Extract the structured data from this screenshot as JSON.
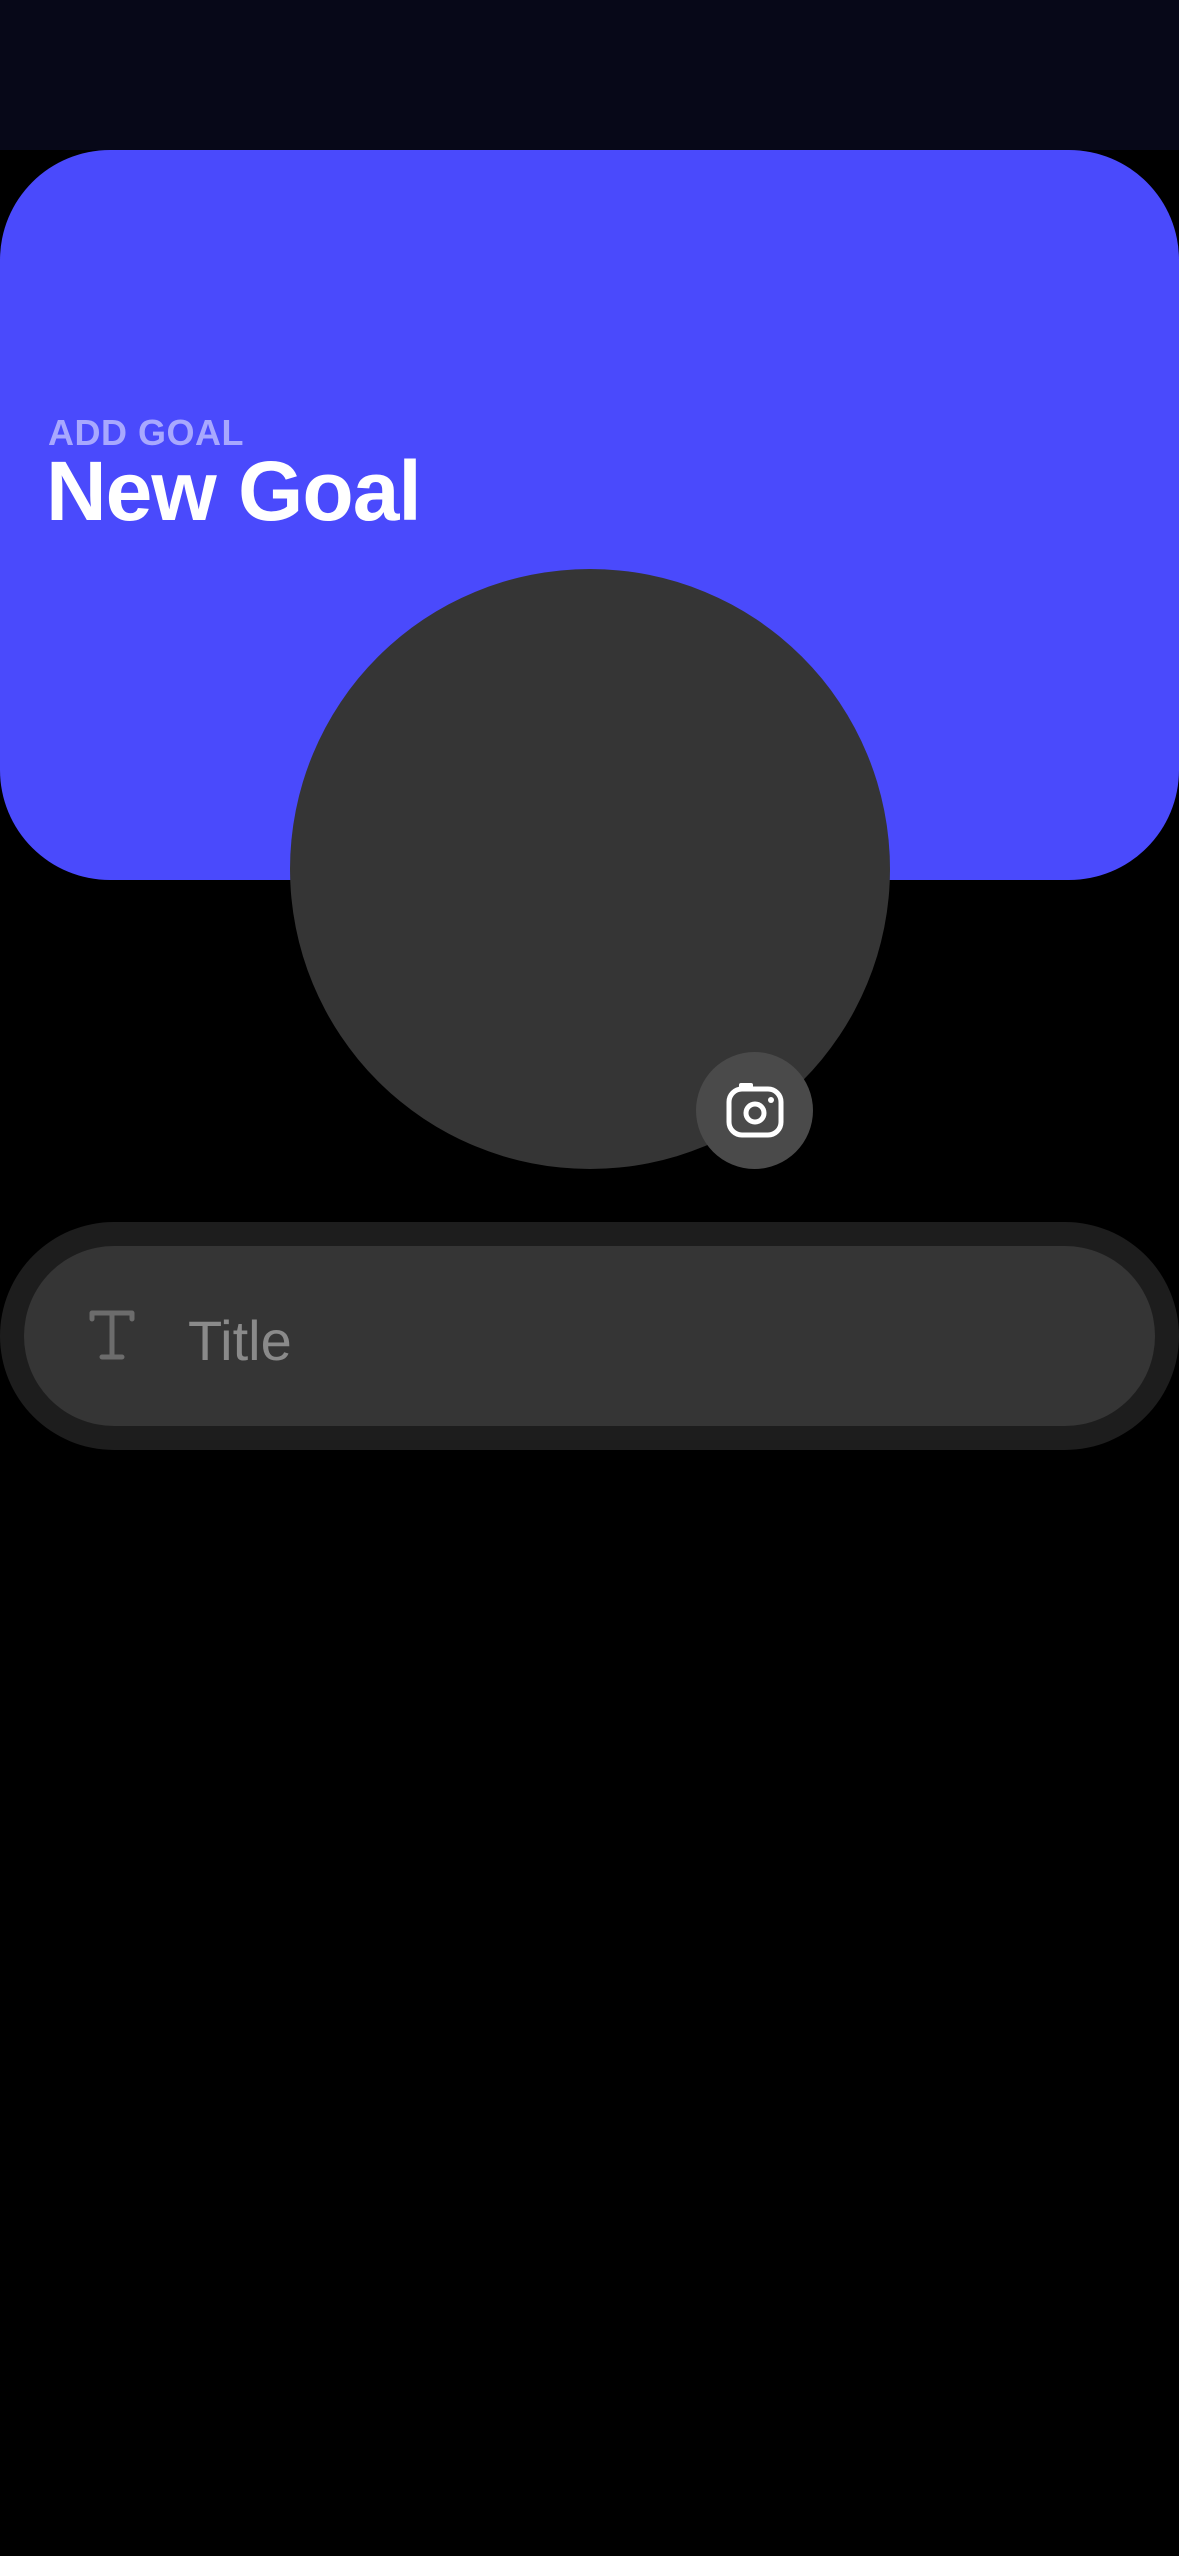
{
  "header": {
    "eyebrow": "ADD GOAL",
    "title": "New Goal",
    "background_color": "#4a4afc"
  },
  "photo": {
    "camera_icon": "camera-icon"
  },
  "form": {
    "title_field": {
      "icon": "text-icon",
      "value": "",
      "placeholder": "Title"
    }
  },
  "colors": {
    "background": "#000000",
    "status_bar": "#070818",
    "circle": "#353535",
    "field": "#353535",
    "field_border": "#1d1d1d"
  }
}
